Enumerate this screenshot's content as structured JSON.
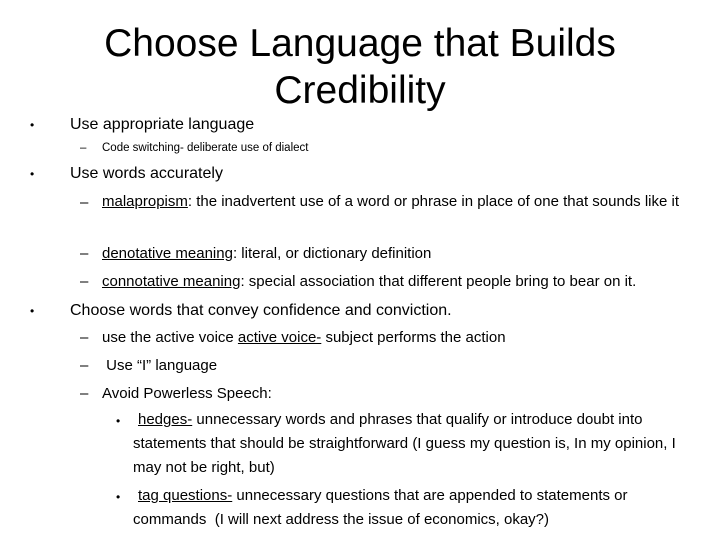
{
  "slide": {
    "title": "Choose Language that Builds Credibility",
    "bullets": [
      {
        "text": "Use appropriate language",
        "sub": [
          {
            "text": "Code switching- deliberate use of dialect"
          }
        ]
      },
      {
        "text": "Use words accurately",
        "sub": [
          {
            "term": "malapropism",
            "rest": ": the inadvertent use of a word or phrase in place of one that sounds like it"
          },
          {
            "term": "denotative meaning",
            "rest": ": literal, or dictionary definition"
          },
          {
            "term": "connotative meaning",
            "rest": ": special association that different people bring to bear on it."
          }
        ]
      },
      {
        "text": "Choose words that convey confidence and conviction.",
        "sub": [
          {
            "pre": "use the active voice ",
            "term": "active voice-",
            "rest": " subject performs the action"
          },
          {
            "text": " Use “I” language"
          },
          {
            "text": "Avoid Powerless Speech:",
            "sub": [
              {
                "term": "hedges-",
                "rest": " unnecessary words and phrases that qualify or introduce doubt into statements that should be straightforward (I guess my question is, In my opinion, I may not be right, but)"
              },
              {
                "term": "tag questions-",
                "rest": " unnecessary questions that are appended to statements or commands  (I will next address the issue of economics, okay?)"
              }
            ]
          }
        ]
      }
    ],
    "glyphs": {
      "bullet": "•",
      "dash": "–"
    }
  }
}
